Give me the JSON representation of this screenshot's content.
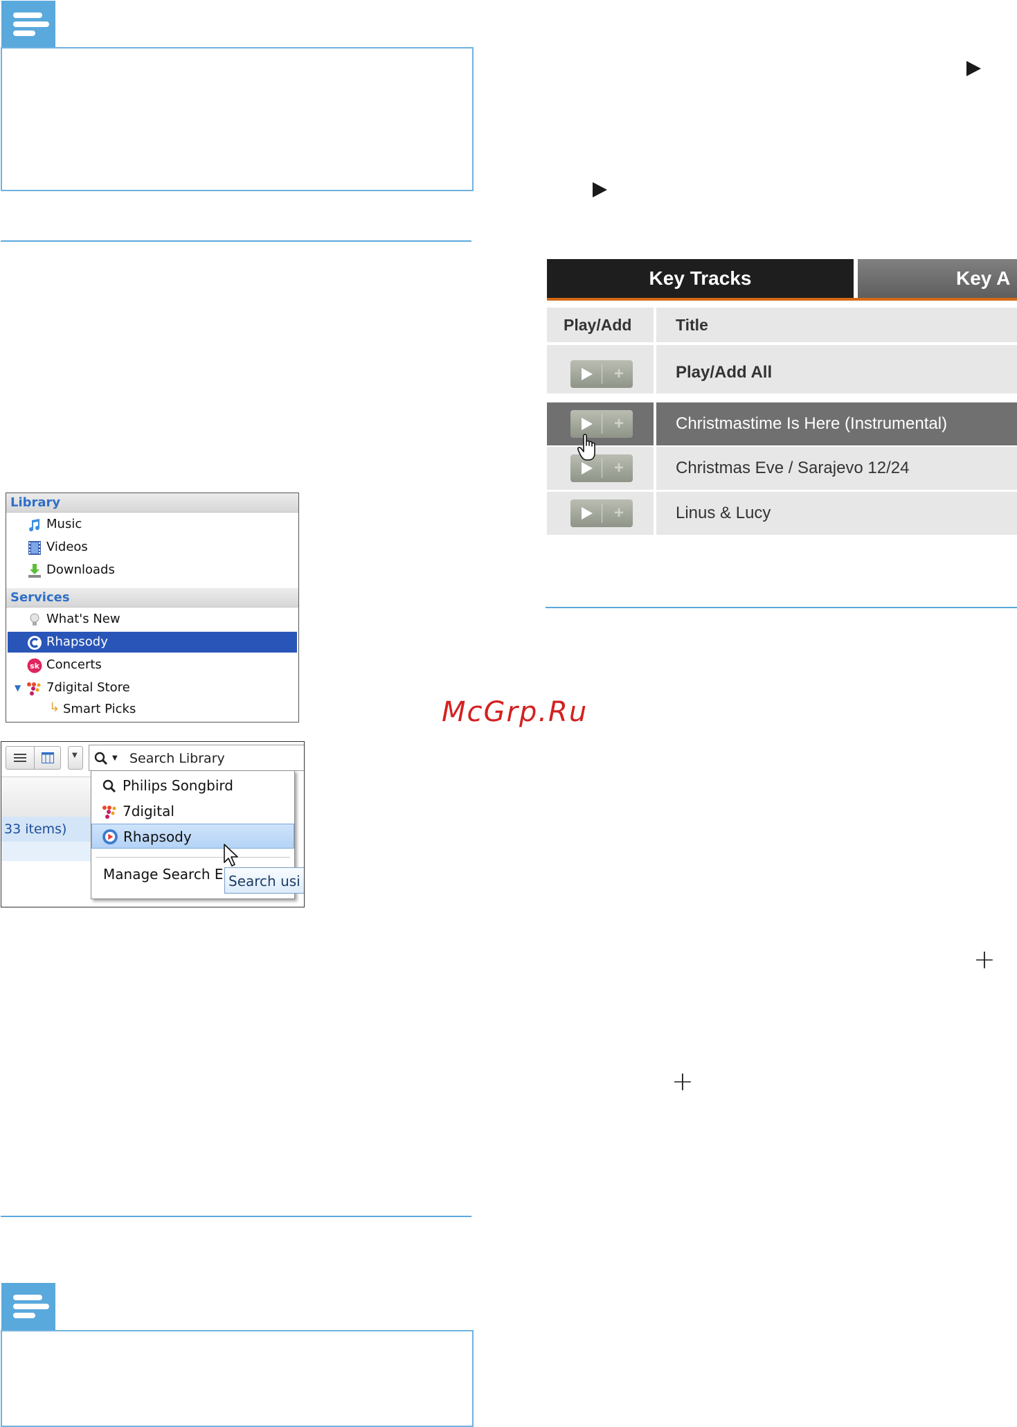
{
  "sidebar": {
    "sections": [
      {
        "title": "Library",
        "items": [
          {
            "label": "Music",
            "icon": "music-note-icon"
          },
          {
            "label": "Videos",
            "icon": "film-icon"
          },
          {
            "label": "Downloads",
            "icon": "download-icon"
          }
        ]
      },
      {
        "title": "Services",
        "items": [
          {
            "label": "What's New",
            "icon": "lightbulb-icon"
          },
          {
            "label": "Rhapsody",
            "icon": "rhapsody-icon",
            "selected": true
          },
          {
            "label": "Concerts",
            "icon": "songkick-icon"
          },
          {
            "label": "7digital Store",
            "icon": "7digital-icon"
          },
          {
            "label": "Smart Picks",
            "icon": "subitem-arrow-icon"
          }
        ]
      }
    ],
    "selected_color": "#2a55b8",
    "header_text_color": "#2f6fc8"
  },
  "search": {
    "placeholder": "Search Library",
    "items_count": "33 items)",
    "options": [
      {
        "label": "Philips Songbird",
        "icon": "search-icon"
      },
      {
        "label": "7digital",
        "icon": "7digital-icon"
      },
      {
        "label": "Rhapsody",
        "icon": "rhapsody-icon",
        "highlighted": true
      }
    ],
    "manage_label": "Manage Search Er",
    "tooltip": "Search usi"
  },
  "key_tracks": {
    "tabs": [
      "Key Tracks",
      "Key A"
    ],
    "columns": [
      "Play/Add",
      "Title"
    ],
    "rows": [
      {
        "title": "Play/Add All",
        "bold": true
      },
      {
        "title": "Christmastime Is Here (Instrumental)",
        "selected": true
      },
      {
        "title": "Christmas Eve / Sarajevo 12/24"
      },
      {
        "title": "Linus & Lucy"
      }
    ],
    "accent_color": "#d46a18"
  },
  "watermark": "McGrp.Ru"
}
